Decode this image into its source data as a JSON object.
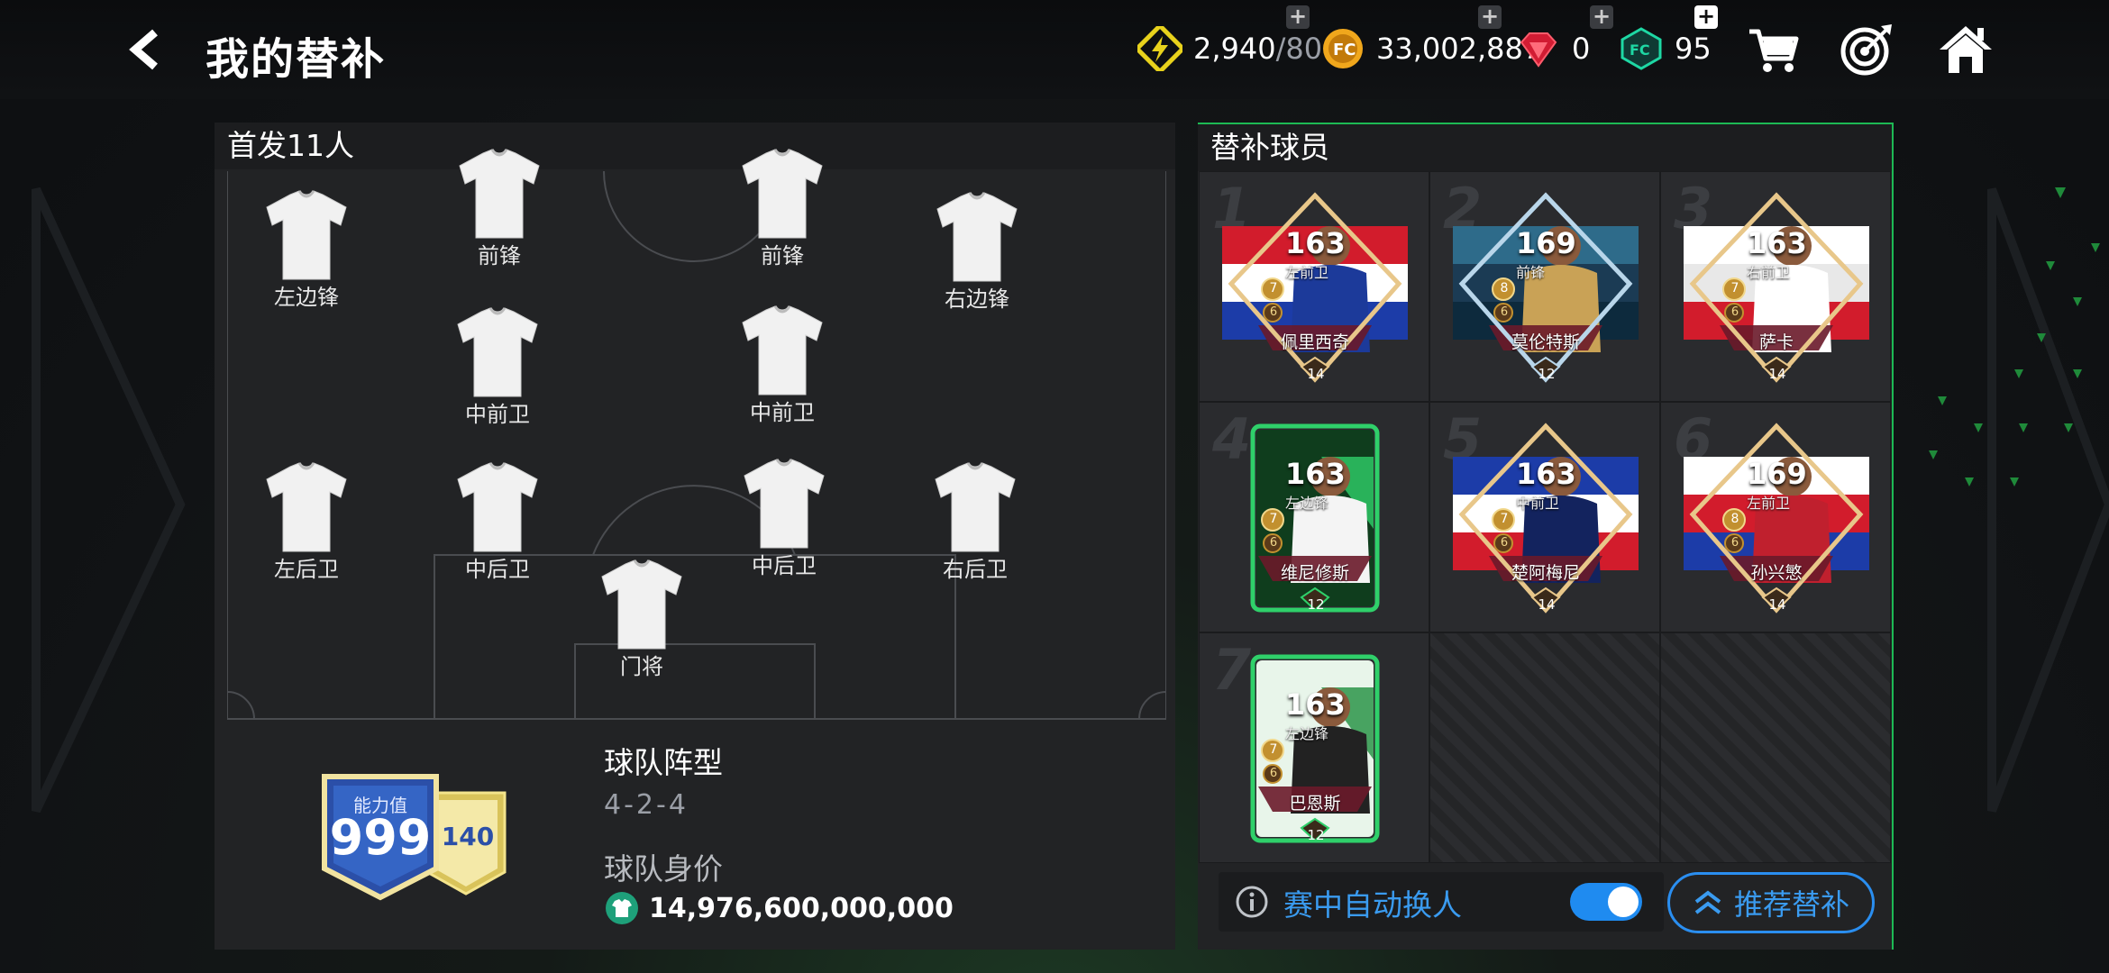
{
  "header": {
    "title": "我的替补",
    "currencies": {
      "energy": {
        "value": "2,940",
        "max": "/80"
      },
      "coins": {
        "value": "33,002,887"
      },
      "gems": {
        "value": "0"
      },
      "tokens": {
        "value": "95"
      }
    },
    "plus_label": "+"
  },
  "lineup": {
    "header": "首发11人",
    "players": [
      {
        "pos": "左边锋"
      },
      {
        "pos": "前锋"
      },
      {
        "pos": "前锋"
      },
      {
        "pos": "右边锋"
      },
      {
        "pos": "中前卫"
      },
      {
        "pos": "中前卫"
      },
      {
        "pos": "左后卫"
      },
      {
        "pos": "中后卫"
      },
      {
        "pos": "中后卫"
      },
      {
        "pos": "右后卫"
      },
      {
        "pos": "门将"
      }
    ],
    "rating_label": "能力值",
    "rating_value": "999",
    "rating_sub": "140",
    "formation_title": "球队阵型",
    "formation_value": "4-2-4",
    "value_title": "球队身价",
    "value_amount": "14,976,600,000,000"
  },
  "substitutes": {
    "header": "替补球员",
    "cards": [
      {
        "num": "1",
        "ovr": "163",
        "pos": "左前卫",
        "name": "佩里西奇",
        "lvl": "14",
        "grade": "7",
        "star": "6",
        "theme": "croatia"
      },
      {
        "num": "2",
        "ovr": "169",
        "pos": "前锋",
        "name": "莫伦特斯",
        "lvl": "12",
        "grade": "8",
        "star": "6",
        "theme": "icon"
      },
      {
        "num": "3",
        "ovr": "163",
        "pos": "右前卫",
        "name": "萨卡",
        "lvl": "14",
        "grade": "7",
        "star": "6",
        "theme": "england"
      },
      {
        "num": "4",
        "ovr": "163",
        "pos": "左边锋",
        "name": "维尼修斯",
        "lvl": "12",
        "grade": "7",
        "star": "6",
        "theme": "green"
      },
      {
        "num": "5",
        "ovr": "163",
        "pos": "中前卫",
        "name": "楚阿梅尼",
        "lvl": "14",
        "grade": "7",
        "star": "6",
        "theme": "france"
      },
      {
        "num": "6",
        "ovr": "169",
        "pos": "左前卫",
        "name": "孙兴慜",
        "lvl": "14",
        "grade": "8",
        "star": "6",
        "theme": "korea"
      },
      {
        "num": "7",
        "ovr": "163",
        "pos": "左边锋",
        "name": "巴恩斯",
        "lvl": "12",
        "grade": "7",
        "star": "6",
        "theme": "green2"
      }
    ],
    "auto_sub_label": "赛中自动换人",
    "auto_sub_enabled": true,
    "recommend_label": "推荐替补"
  }
}
